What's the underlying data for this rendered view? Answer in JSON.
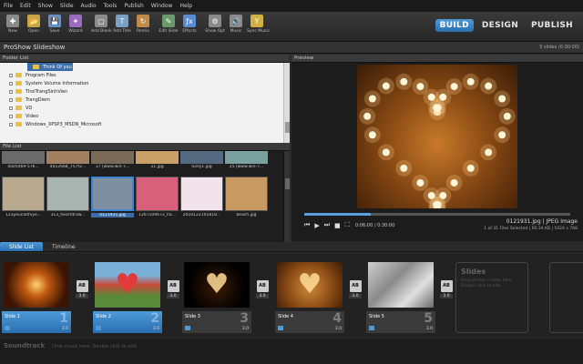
{
  "menu": [
    "File",
    "Edit",
    "Show",
    "Slide",
    "Audio",
    "Tools",
    "Publish",
    "Window",
    "Help"
  ],
  "toolbar": {
    "tools": [
      {
        "label": "New",
        "icon": "new-show-icon"
      },
      {
        "label": "Open",
        "icon": "open-folder-icon"
      },
      {
        "label": "Save",
        "icon": "save-disk-icon"
      },
      {
        "label": "Wizard",
        "icon": "wizard-icon"
      },
      {
        "label": "Add Blank",
        "icon": "add-blank-icon"
      },
      {
        "label": "Add Title",
        "icon": "add-title-icon"
      },
      {
        "label": "Remix",
        "icon": "remix-icon"
      },
      {
        "label": "Edit Slide",
        "icon": "edit-slide-icon"
      },
      {
        "label": "Effects",
        "icon": "effects-fx-icon"
      },
      {
        "label": "Show Opt",
        "icon": "show-options-icon"
      },
      {
        "label": "Music",
        "icon": "music-speaker-icon"
      },
      {
        "label": "Sync Music",
        "icon": "sync-music-icon"
      }
    ],
    "modes": [
      {
        "label": "BUILD",
        "active": true
      },
      {
        "label": "DESIGN",
        "active": false
      },
      {
        "label": "PUBLISH",
        "active": false
      }
    ]
  },
  "titlebar": {
    "title": "ProShow Slideshow",
    "count": "5 slides (0:30:00)"
  },
  "folder_list": {
    "header": "Folder List",
    "selected": "Think Of you",
    "items": [
      "Program Files",
      "System Volume Information",
      "ThoiTrangSinhVien",
      "TrangDiem",
      "VD",
      "Video",
      "Windows_XPSP3_MSDN_Microsoft"
    ]
  },
  "file_list": {
    "header": "File List",
    "top_row": [
      "4a05469-576...",
      "4a12668_757f2...",
      "17 [www.win-7...",
      "21.jpg",
      "02ily1.jpg",
      "25 [www.win-7..."
    ],
    "bottom_row": [
      {
        "name": "123yeucaithiye...",
        "color": "#b9a98e"
      },
      {
        "name": "313_heartdraw...",
        "color": "#a7b4b0"
      },
      {
        "name": "0121931.jpg",
        "color": "#7d8fa0",
        "selected": true
      },
      {
        "name": "1267109672_ha...",
        "color": "#d8607a"
      },
      {
        "name": "2010122101818...",
        "color": "#f2e2ea"
      },
      {
        "name": "beach.jpg",
        "color": "#c89a62"
      }
    ]
  },
  "preview": {
    "header": "Preview",
    "time": "0:06:00 / 0:30:00",
    "file": "0121931.jpg  |  JPEG Image",
    "meta": "1 of 31 Files Selected | 60.34 KB | 1024 x 768"
  },
  "tabs": [
    {
      "label": "Slide List",
      "active": true
    },
    {
      "label": "Timeline",
      "active": false
    }
  ],
  "slides": [
    {
      "name": "Slide 1",
      "num": "1",
      "dur": "3.0",
      "thumb": "starburst",
      "selected": true
    },
    {
      "name": "Slide 2",
      "num": "2",
      "dur": "3.0",
      "thumb": "flower-heart",
      "selected": true
    },
    {
      "name": "Slide 3",
      "num": "3",
      "dur": "3.0",
      "thumb": "candle-heart-dark",
      "selected": false
    },
    {
      "name": "Slide 4",
      "num": "4",
      "dur": "3.0",
      "thumb": "candle-heart-orange",
      "selected": false
    },
    {
      "name": "Slide 5",
      "num": "5",
      "dur": "3.0",
      "thumb": "gray-texture",
      "selected": false
    }
  ],
  "transitions": [
    "3.0",
    "3.0",
    "3.0",
    "3.0",
    "3.0"
  ],
  "slides_placeholder": {
    "title": "Slides",
    "desc": "Drop photos / video here. Double click to edit."
  },
  "soundtrack": {
    "label": "Soundtrack",
    "desc": "Drop music here.  Double click to edit."
  }
}
